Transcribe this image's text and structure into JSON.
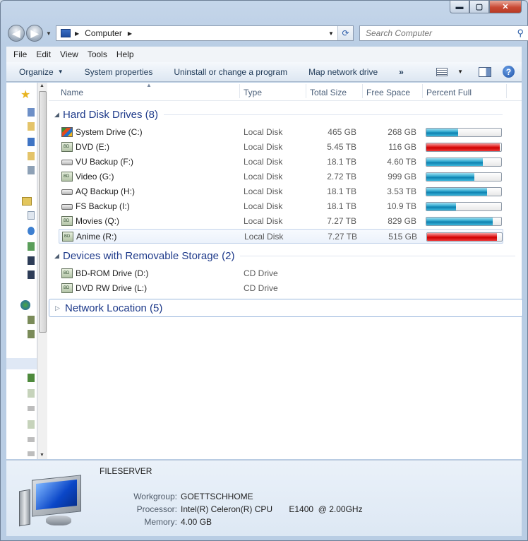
{
  "window": {
    "min_label": "▬",
    "max_label": "▢",
    "close_label": "✕"
  },
  "address": {
    "location": "Computer",
    "search_placeholder": "Search Computer"
  },
  "menu": [
    "File",
    "Edit",
    "View",
    "Tools",
    "Help"
  ],
  "commands": {
    "organize": "Organize",
    "system_properties": "System properties",
    "uninstall": "Uninstall or change a program",
    "map_drive": "Map network drive",
    "more": "»",
    "help": "?"
  },
  "columns": {
    "name": "Name",
    "type": "Type",
    "total": "Total Size",
    "free": "Free Space",
    "percent": "Percent Full"
  },
  "groups": {
    "hdd": "Hard Disk Drives (8)",
    "removable": "Devices with Removable Storage (2)",
    "network": "Network Location (5)"
  },
  "hard_disks": [
    {
      "name": "System Drive (C:)",
      "type": "Local Disk",
      "total": "465 GB",
      "free": "268 GB",
      "percent_full": 42,
      "critical": false,
      "icon": "windows-drive-icon"
    },
    {
      "name": "DVD (E:)",
      "type": "Local Disk",
      "total": "5.45 TB",
      "free": "116 GB",
      "percent_full": 98,
      "critical": true,
      "icon": "media-drive-icon"
    },
    {
      "name": "VU Backup (F:)",
      "type": "Local Disk",
      "total": "18.1 TB",
      "free": "4.60 TB",
      "percent_full": 75,
      "critical": false,
      "icon": "hard-drive-icon"
    },
    {
      "name": "Video (G:)",
      "type": "Local Disk",
      "total": "2.72 TB",
      "free": "999 GB",
      "percent_full": 64,
      "critical": false,
      "icon": "media-drive-icon"
    },
    {
      "name": "AQ Backup (H:)",
      "type": "Local Disk",
      "total": "18.1 TB",
      "free": "3.53 TB",
      "percent_full": 81,
      "critical": false,
      "icon": "hard-drive-icon"
    },
    {
      "name": "FS Backup (I:)",
      "type": "Local Disk",
      "total": "18.1 TB",
      "free": "10.9 TB",
      "percent_full": 40,
      "critical": false,
      "icon": "hard-drive-icon"
    },
    {
      "name": "Movies (Q:)",
      "type": "Local Disk",
      "total": "7.27 TB",
      "free": "829 GB",
      "percent_full": 89,
      "critical": false,
      "icon": "media-drive-icon"
    },
    {
      "name": "Anime (R:)",
      "type": "Local Disk",
      "total": "7.27 TB",
      "free": "515 GB",
      "percent_full": 93,
      "critical": true,
      "icon": "media-drive-icon"
    }
  ],
  "removable": [
    {
      "name": "BD-ROM Drive (D:)",
      "type": "CD Drive",
      "icon": "optical-drive-icon"
    },
    {
      "name": "DVD RW Drive (L:)",
      "type": "CD Drive",
      "icon": "optical-drive-icon"
    }
  ],
  "details": {
    "computer_name": "FILESERVER",
    "workgroup_label": "Workgroup:",
    "workgroup": "GOETTSCHHOME",
    "processor_label": "Processor:",
    "processor": "Intel(R) Celeron(R) CPU       E1400  @ 2.00GHz",
    "memory_label": "Memory:",
    "memory": "4.00 GB"
  },
  "colors": {
    "bar_normal": "#1e9ac6",
    "bar_critical": "#d81616",
    "group_header": "#1e3a8a"
  }
}
